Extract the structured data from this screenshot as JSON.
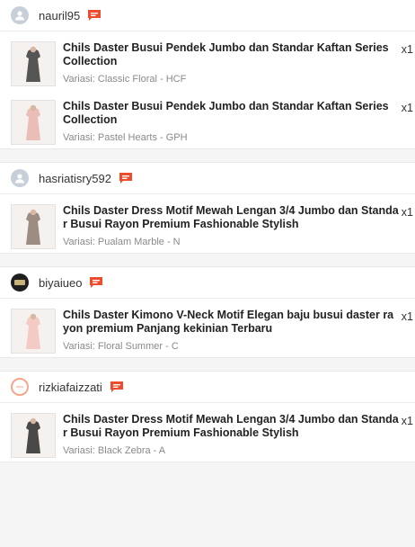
{
  "orders": [
    {
      "username": "nauril95",
      "avatar_type": "default",
      "items": [
        {
          "title": "Chils Daster Busui Pendek Jumbo dan Standar Kaftan Series Collection",
          "variant": "Variasi: Classic Floral - HCF",
          "qty": "x1",
          "thumb_color": "#3a3a3a"
        },
        {
          "title": "Chils Daster Busui Pendek Jumbo dan Standar Kaftan Series Collection",
          "variant": "Variasi: Pastel Hearts - GPH",
          "qty": "x1",
          "thumb_color": "#e9b4ad"
        }
      ]
    },
    {
      "username": "hasriatisry592",
      "avatar_type": "default",
      "items": [
        {
          "title": "Chils Daster Dress Motif Mewah Lengan 3/4 Jumbo dan Standar Busui Rayon Premium Fashionable Stylish",
          "variant": "Variasi: Pualam Marble - N",
          "qty": "x1",
          "thumb_color": "#8c7a6e"
        }
      ]
    },
    {
      "username": "biyaiueo",
      "avatar_type": "dark",
      "items": [
        {
          "title": "Chils Daster Kimono V-Neck Motif Elegan baju busui daster rayon premium Panjang kekinian Terbaru",
          "variant": "Variasi: Floral Summer - C",
          "qty": "x1",
          "thumb_color": "#f2c4bc"
        }
      ]
    },
    {
      "username": "rizkiafaizzati",
      "avatar_type": "ring",
      "items": [
        {
          "title": "Chils Daster Dress Motif Mewah Lengan 3/4 Jumbo dan Standar Busui Rayon Premium Fashionable Stylish",
          "variant": "Variasi: Black Zebra - A",
          "qty": "x1",
          "thumb_color": "#2b2b2b"
        }
      ]
    }
  ],
  "icons": {
    "chat": "chat-bubble-icon",
    "avatar": "user-avatar-icon"
  },
  "colors": {
    "accent": "#ee4d2d"
  }
}
